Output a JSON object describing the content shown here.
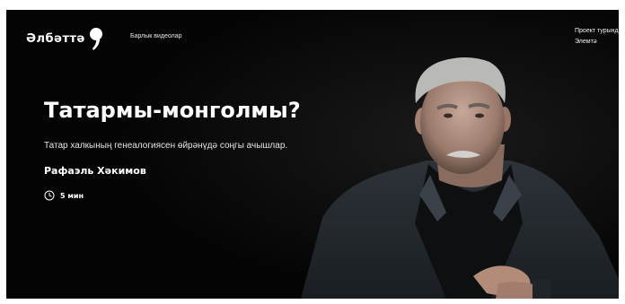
{
  "header": {
    "logo_text": "Әлбәттә",
    "nav_all_videos": "Барлык видеолар",
    "project_link": "Проект турында",
    "second_link": "Элемтә"
  },
  "hero": {
    "title": "Татармы-монголмы?",
    "subtitle": "Татар халкының генеалогиясен өйрәнүдә соңгы ачышлар.",
    "author": "Рафаэль Хәкимов",
    "duration": "5 мин"
  },
  "colors": {
    "background": "#050505",
    "text": "#ffffff"
  }
}
